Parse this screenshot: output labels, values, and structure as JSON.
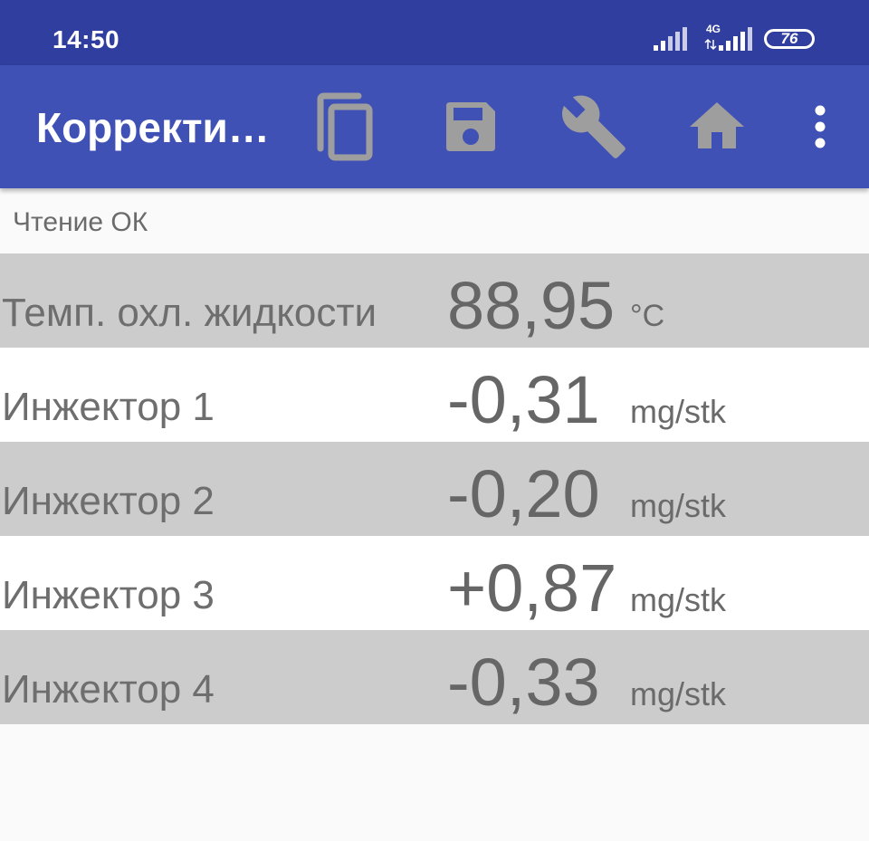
{
  "status_bar": {
    "time": "14:50",
    "network_label": "4G",
    "battery_level": "76",
    "icons": [
      "signal-icon",
      "signal-4g-icon",
      "battery-icon"
    ]
  },
  "app_bar": {
    "title": "Корректи…",
    "actions": [
      {
        "name": "copy",
        "icon": "copy-icon"
      },
      {
        "name": "save",
        "icon": "save-icon"
      },
      {
        "name": "settings",
        "icon": "wrench-icon"
      },
      {
        "name": "home",
        "icon": "home-icon"
      },
      {
        "name": "overflow",
        "icon": "more-vert-icon"
      }
    ],
    "colors": {
      "bar": "#3f51b5",
      "status": "#303f9f",
      "icons": "#9e9e9e"
    }
  },
  "read_status": "Чтение ОК",
  "rows": [
    {
      "label": "Темп. охл. жидкости",
      "value": "88,95",
      "unit": "°C"
    },
    {
      "label": "Инжектор 1",
      "value": "-0,31",
      "unit": "mg/stk"
    },
    {
      "label": "Инжектор 2",
      "value": "-0,20",
      "unit": "mg/stk"
    },
    {
      "label": "Инжектор 3",
      "value": "+0,87",
      "unit": "mg/stk"
    },
    {
      "label": "Инжектор 4",
      "value": "-0,33",
      "unit": "mg/stk"
    }
  ]
}
